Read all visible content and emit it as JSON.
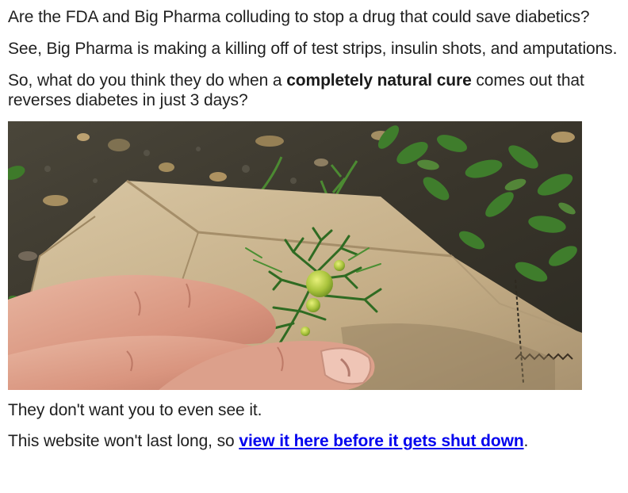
{
  "article": {
    "paragraph_1": "Are the FDA and Big Pharma colluding to stop a drug that could save diabetics?",
    "paragraph_2": "See, Big Pharma is making a killing off of test strips, insulin shots, and amputations.",
    "paragraph_3": {
      "before": "So, what do you think they do when a ",
      "emphasis": "completely natural cure",
      "after": " comes out that reverses diabetes in just 3 days?"
    },
    "paragraph_4": "They don't want you to even see it.",
    "paragraph_5": {
      "before": "This website won't last long, so ",
      "link": "view it here before it gets shut down",
      "after": "."
    }
  },
  "photo": {
    "icon": "photo-plant-in-hand"
  },
  "colors": {
    "text": "#1f1f1f",
    "link": "#0000ee",
    "soil": "#3c3a30",
    "paper_bag": "#c9b48f",
    "leaf_green": "#3f7d2c",
    "skin": "#d99a86"
  }
}
